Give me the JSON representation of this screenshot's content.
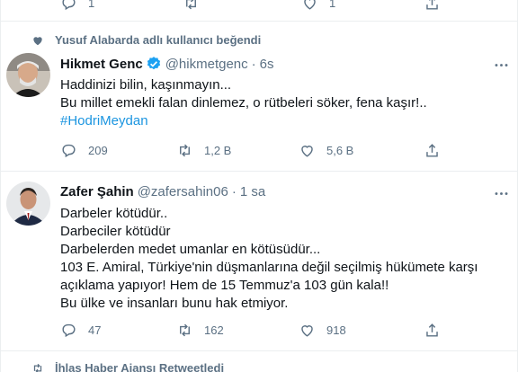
{
  "top_actions": {
    "reply_count": "1",
    "like_count": "1"
  },
  "tweet1": {
    "social_context": "Yusuf Alabarda adlı kullanıcı beğendi",
    "author_name": "Hikmet Genc",
    "author_handle": "@hikmetgenc",
    "separator": "·",
    "time": "6s",
    "lines": [
      "Haddinizi bilin, kaşınmayın...",
      "Bu millet emekli falan dinlemez, o rütbeleri söker, fena kaşır!.."
    ],
    "hashtag": "#HodriMeydan",
    "reply_count": "209",
    "retweet_count": "1,2 B",
    "like_count": "5,6 B"
  },
  "tweet2": {
    "author_name": "Zafer Şahin",
    "author_handle": "@zafersahin06",
    "separator": "·",
    "time": "1 sa",
    "lines": [
      "Darbeler kötüdür..",
      "Darbeciler kötüdür",
      "Darbelerden medet umanlar en kötüsüdür...",
      "103 E. Amiral, Türkiye'nin düşmanlarına değil seçilmiş hükümete karşı",
      "açıklama yapıyor! Hem de 15 Temmuz'a 103 gün kala!!",
      "Bu ülke ve insanları bunu hak etmiyor."
    ],
    "reply_count": "47",
    "retweet_count": "162",
    "like_count": "918"
  },
  "tweet3": {
    "social_context": "İhlas Haber Ajansı Retweetledi"
  },
  "colors": {
    "secondary": "#5b7083",
    "accent": "#1da1f2",
    "link": "#1b95e0",
    "border": "#ebeef0"
  }
}
